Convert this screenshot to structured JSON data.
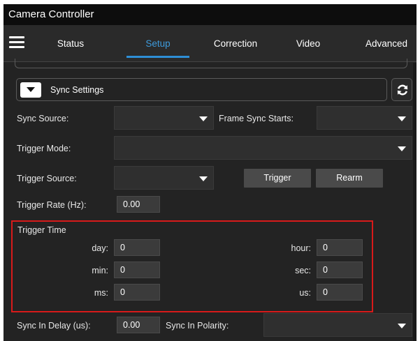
{
  "window": {
    "title": "Camera Controller"
  },
  "nav": {
    "tabs": [
      {
        "label": "Status"
      },
      {
        "label": "Setup"
      },
      {
        "label": "Correction"
      },
      {
        "label": "Video"
      },
      {
        "label": "Advanced"
      }
    ],
    "active_tab": "Setup"
  },
  "section": {
    "title": "Sync Settings"
  },
  "form": {
    "sync_source_label": "Sync Source:",
    "sync_source_value": "",
    "frame_sync_starts_label": "Frame Sync Starts:",
    "frame_sync_starts_value": "",
    "trigger_mode_label": "Trigger Mode:",
    "trigger_mode_value": "",
    "trigger_source_label": "Trigger Source:",
    "trigger_source_value": "",
    "trigger_button": "Trigger",
    "rearm_button": "Rearm",
    "trigger_rate_label": "Trigger Rate (Hz):",
    "trigger_rate_value": "0.00",
    "trigger_time": {
      "title": "Trigger Time",
      "day_label": "day:",
      "day_value": "0",
      "hour_label": "hour:",
      "hour_value": "0",
      "min_label": "min:",
      "min_value": "0",
      "sec_label": "sec:",
      "sec_value": "0",
      "ms_label": "ms:",
      "ms_value": "0",
      "us_label": "us:",
      "us_value": "0"
    },
    "sync_in_delay_label": "Sync In Delay (us):",
    "sync_in_delay_value": "0.00",
    "sync_in_polarity_label": "Sync In Polarity:",
    "sync_in_polarity_value": ""
  },
  "colors": {
    "accent": "#3e9bdc",
    "highlight_border": "#d81a1a",
    "background": "#232323"
  },
  "icons": {
    "menu": "hamburger-icon",
    "collapse": "caret-down-icon",
    "refresh": "refresh-icon",
    "dropdown": "caret-down-icon"
  }
}
